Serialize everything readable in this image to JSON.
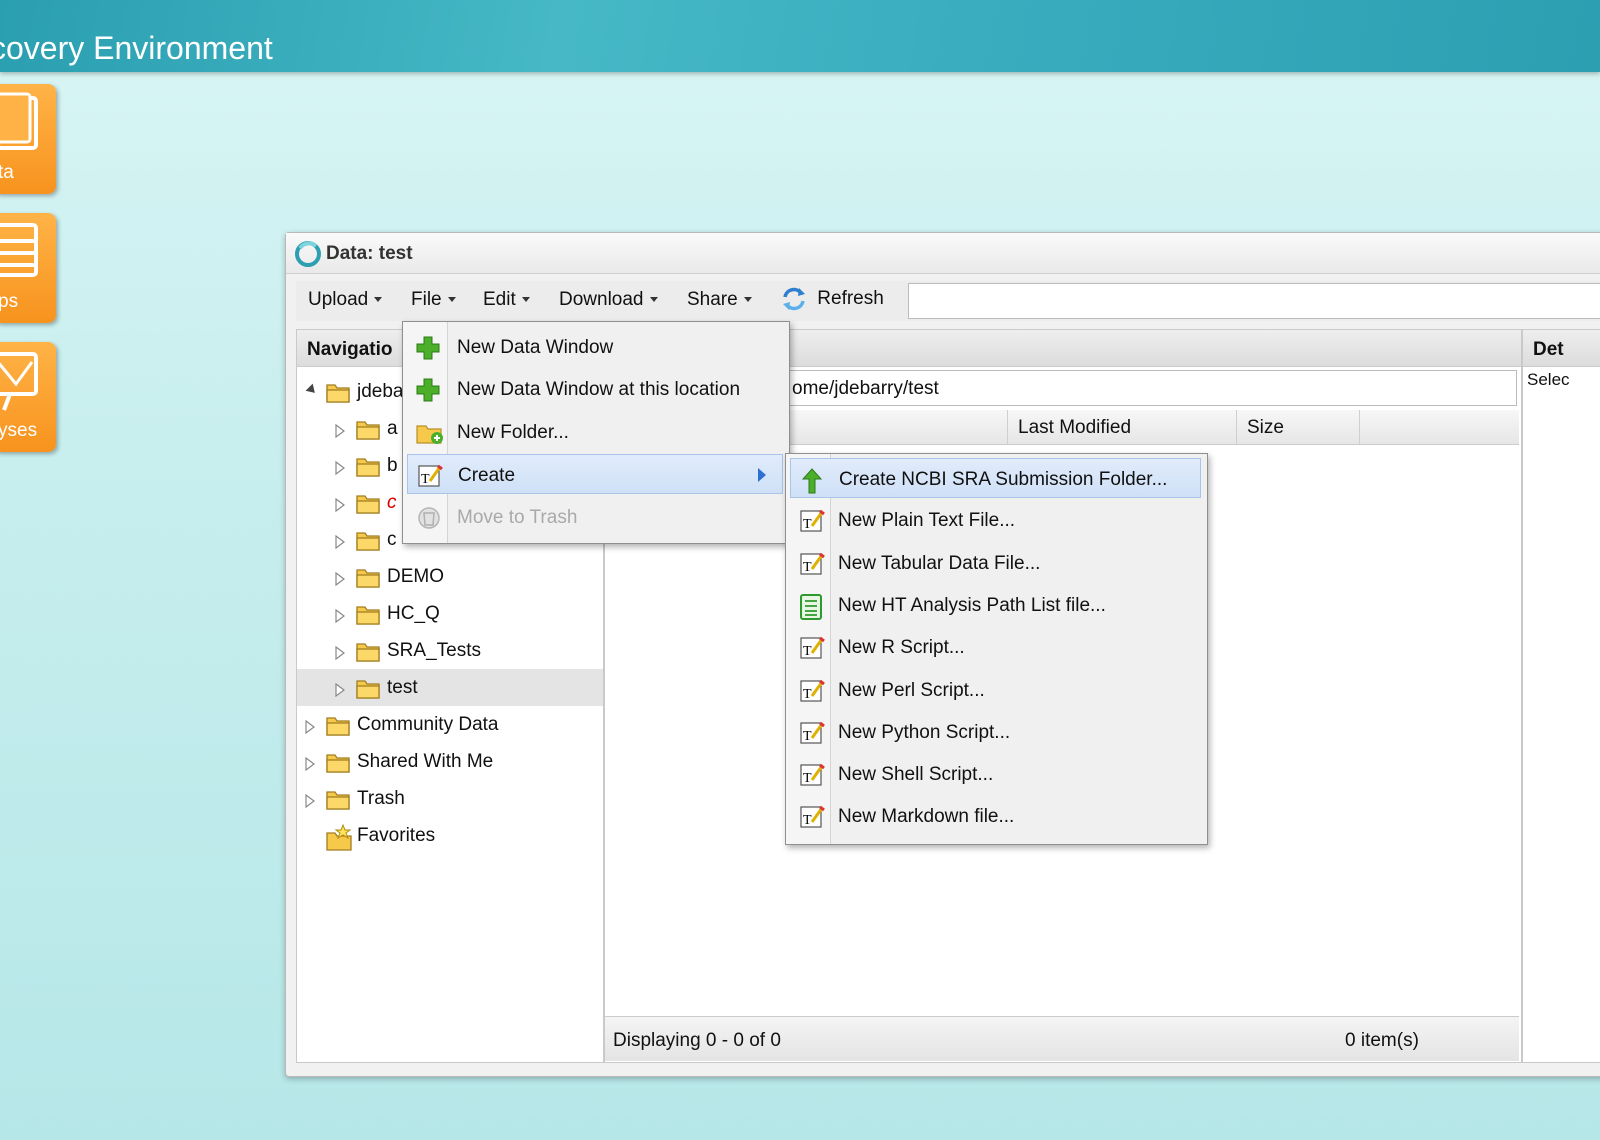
{
  "app": {
    "title": "covery Environment"
  },
  "tiles": [
    {
      "label": "ta",
      "icon": "data-icon"
    },
    {
      "label": "ps",
      "icon": "apps-icon"
    },
    {
      "label": "yses",
      "icon": "analyses-icon"
    }
  ],
  "window": {
    "title": "Data: test",
    "toolbar": {
      "upload": "Upload",
      "file": "File",
      "edit": "Edit",
      "download": "Download",
      "share": "Share",
      "refresh": "Refresh"
    },
    "navigation": {
      "header": "Navigatio",
      "tree": [
        {
          "label": "jdeba",
          "level": 0,
          "expanded": true
        },
        {
          "label": "a",
          "level": 1
        },
        {
          "label": "b",
          "level": 1
        },
        {
          "label": "c",
          "level": 1,
          "red": true
        },
        {
          "label": "c",
          "level": 1
        },
        {
          "label": "DEMO",
          "level": 1
        },
        {
          "label": "HC_Q",
          "level": 1
        },
        {
          "label": "SRA_Tests",
          "level": 1
        },
        {
          "label": "test",
          "level": 1,
          "selected": true
        },
        {
          "label": "Community Data",
          "level": 0
        },
        {
          "label": "Shared With Me",
          "level": 0
        },
        {
          "label": "Trash",
          "level": 0
        },
        {
          "label": "Favorites",
          "level": 0,
          "favorites": true
        }
      ]
    },
    "center": {
      "path": "ome/jdebarry/test",
      "columns": {
        "last_modified": "Last Modified",
        "size": "Size"
      },
      "status_left": "Displaying 0 - 0 of 0",
      "status_right": "0 item(s)"
    },
    "details": {
      "title": "Det",
      "hint": "Selec"
    }
  },
  "file_menu": {
    "items": [
      {
        "label": "New Data Window",
        "icon": "plus-icon"
      },
      {
        "label": "New Data Window at this location",
        "icon": "plus-icon"
      },
      {
        "label": "New Folder...",
        "icon": "new-folder-icon"
      },
      {
        "label": "Create",
        "icon": "create-file-icon",
        "submenu": true
      },
      {
        "label": "Move to Trash",
        "icon": "trash-icon",
        "disabled": true
      }
    ]
  },
  "create_submenu": {
    "items": [
      {
        "label": "Create NCBI SRA Submission Folder...",
        "icon": "green-up-arrow-icon"
      },
      {
        "label": "New Plain Text File...",
        "icon": "text-file-icon"
      },
      {
        "label": "New Tabular Data File...",
        "icon": "text-file-icon"
      },
      {
        "label": "New HT Analysis Path List file...",
        "icon": "path-list-icon"
      },
      {
        "label": "New R Script...",
        "icon": "text-file-icon"
      },
      {
        "label": "New Perl Script...",
        "icon": "text-file-icon"
      },
      {
        "label": "New Python Script...",
        "icon": "text-file-icon"
      },
      {
        "label": "New Shell Script...",
        "icon": "text-file-icon"
      },
      {
        "label": "New Markdown file...",
        "icon": "text-file-icon"
      }
    ]
  }
}
